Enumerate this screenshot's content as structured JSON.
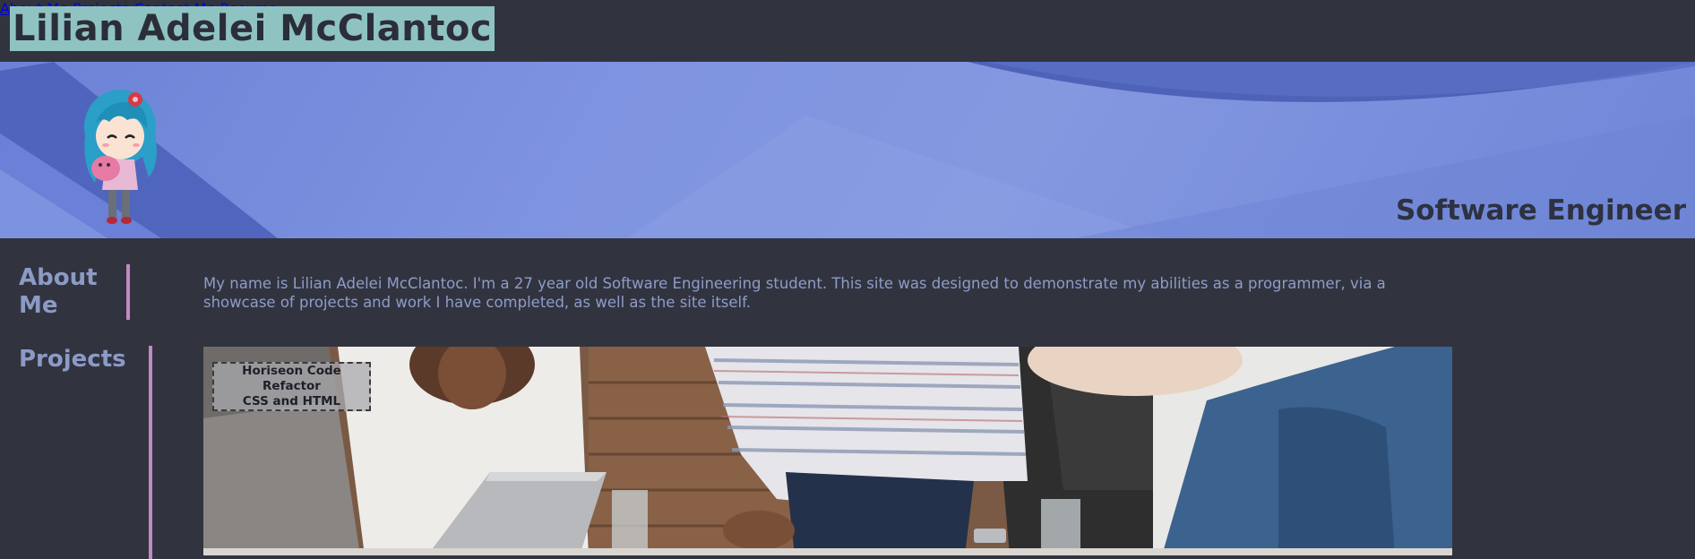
{
  "header": {
    "site_title": "Lilian Adelei McClantoc",
    "nav": [
      {
        "label": "About Me"
      },
      {
        "label": "Projects"
      },
      {
        "label": "Contact Me"
      },
      {
        "label": "Resume"
      }
    ]
  },
  "hero": {
    "subtitle": "Software Engineer",
    "avatar_icon": "chibi-avatar-icon"
  },
  "sections": {
    "about": {
      "label": "About Me",
      "text": "My name is Lilian Adelei McClantoc. I'm a 27 year old Software Engineering student. This site was designed to demonstrate my abilities as a programmer, via a showcase of projects and work I have completed, as well as the site itself."
    },
    "projects": {
      "label": "Projects",
      "items": [
        {
          "title": "Horiseon Code Refactor",
          "subtitle": "CSS and HTML"
        }
      ]
    }
  },
  "colors": {
    "background": "#31343f",
    "accent_teal": "#8fc3c2",
    "accent_pink": "#c28ac0",
    "text_muted_blue": "#8e9cc8",
    "hero_blue": "#7f94e0"
  }
}
